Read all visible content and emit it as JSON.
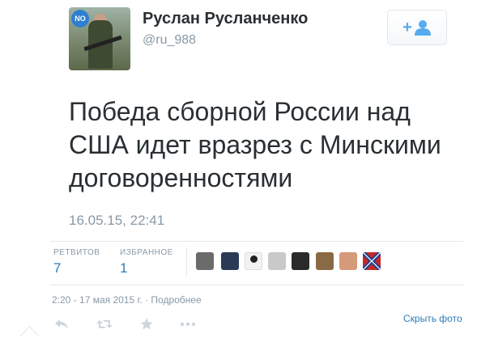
{
  "user": {
    "name": "Руслан Русланченко",
    "handle": "@ru_988",
    "avatar_badge": "NO"
  },
  "follow_button": {
    "icon": "follow-plus-user-icon",
    "color": "#55acee"
  },
  "tweet": {
    "lines": [
      "Победа сборной России над",
      "США идет вразрез с Минскими",
      "договоренностями"
    ]
  },
  "timestamp_overlay": "16.05.15, 22:41",
  "stats": {
    "retweets_label": "РЕТВИТОВ",
    "retweets_count": "7",
    "favorites_label": "ИЗБРАННОЕ",
    "favorites_count": "1"
  },
  "favoriters": [
    {
      "icon": "user-avatar-1",
      "color": "#6b6b6b"
    },
    {
      "icon": "user-avatar-2",
      "color": "#2a3b55"
    },
    {
      "icon": "user-avatar-3",
      "color": "#f2f2f2"
    },
    {
      "icon": "user-avatar-4",
      "color": "#c9c9c9"
    },
    {
      "icon": "user-avatar-5",
      "color": "#2b2b2b"
    },
    {
      "icon": "user-avatar-6",
      "color": "#8a6a45"
    },
    {
      "icon": "user-avatar-7",
      "color": "#d59a7a"
    },
    {
      "icon": "user-avatar-8",
      "color": "#8a8a8a"
    },
    {
      "icon": "user-avatar-flag",
      "color": "#c62828"
    }
  ],
  "details": {
    "date_text": "2:20 - 17 мая 2015 г.",
    "separator": "·",
    "details_link": "Подробнее"
  },
  "hide_photo_link": "Скрыть фото",
  "actions": [
    "reply-icon",
    "retweet-icon",
    "favorite-icon",
    "more-icon"
  ],
  "colors": {
    "link": "#2b7bb9",
    "muted": "#8899a6",
    "text": "#292f33"
  }
}
